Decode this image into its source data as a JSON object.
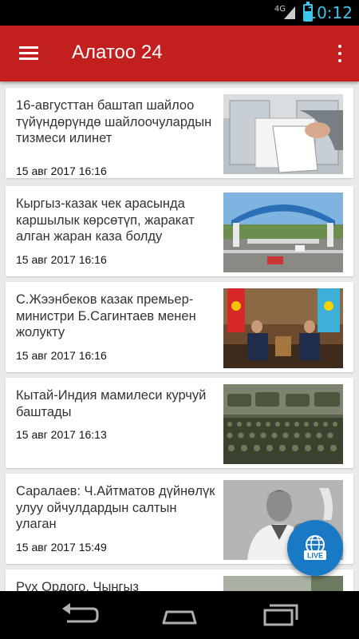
{
  "status_bar": {
    "network": "4G",
    "time": "10:12"
  },
  "app_bar": {
    "title": "Алатоо 24",
    "menu_icon": "hamburger-menu-icon",
    "overflow_icon": "more-vertical-icon"
  },
  "news": [
    {
      "headline": "16-августтан баштап шайлоо түйүндөрүндө шайлоочулардын тизмеси илинет",
      "date": "15 авг 2017 16:16",
      "image": "ballot-box-photo"
    },
    {
      "headline": "Кыргыз-казак чек арасында каршылык көрсөтүп, жаракат алган жаран каза болду",
      "date": "15 авг 2017 16:16",
      "image": "border-checkpoint-photo"
    },
    {
      "headline": "С.Жээнбеков казак премьер-министри Б.Сагинтаев менен жолукту",
      "date": "15 авг 2017 16:16",
      "image": "officials-meeting-photo"
    },
    {
      "headline": "Кытай-Индия мамилеси курчуй баштады",
      "date": "15 авг 2017 16:13",
      "image": "military-parade-photo"
    },
    {
      "headline": "Саралаев: Ч.Айтматов дүйнөлүк улуу ойчулдардын салтын улаган",
      "date": "15 авг 2017 15:49",
      "image": "writer-portrait-photo"
    },
    {
      "headline": "Рух Ордого, Чыңгыз",
      "date": "",
      "image": "partial-photo"
    }
  ],
  "fab": {
    "label": "LIVE",
    "icon": "live-globe-icon",
    "color": "#1a79c4"
  },
  "colors": {
    "app_bar": "#c41f1f",
    "background": "#e9e9e9",
    "status_accent": "#3ec5ea"
  },
  "nav_bar": {
    "back_icon": "back-icon",
    "home_icon": "home-icon",
    "recents_icon": "recents-icon"
  }
}
